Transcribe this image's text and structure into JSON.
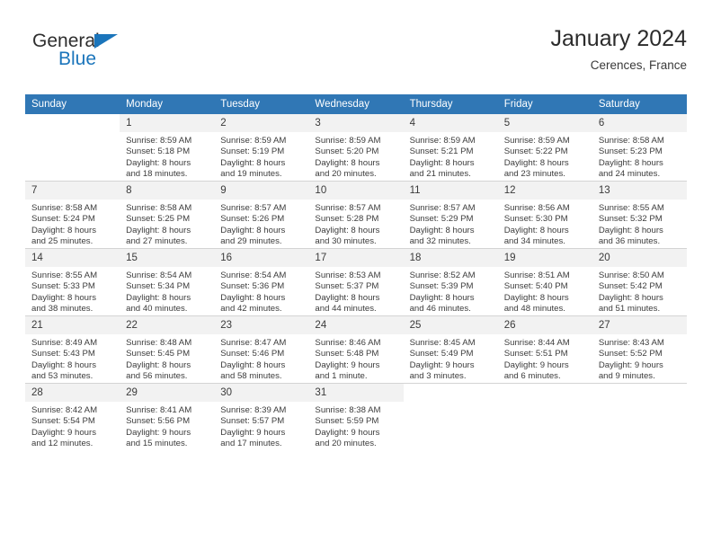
{
  "brand": {
    "name_top": "General",
    "name_bottom": "Blue",
    "accent_color": "#1b75bb"
  },
  "header": {
    "title": "January 2024",
    "subtitle": "Cerences, France",
    "header_bg_color": "#3077b5",
    "daynum_bg_color": "#f2f2f2"
  },
  "weekday_headers": [
    "Sunday",
    "Monday",
    "Tuesday",
    "Wednesday",
    "Thursday",
    "Friday",
    "Saturday"
  ],
  "weeks": [
    [
      {
        "day": "",
        "sunrise": "",
        "sunset": "",
        "daylight_line1": "",
        "daylight_line2": ""
      },
      {
        "day": "1",
        "sunrise": "Sunrise: 8:59 AM",
        "sunset": "Sunset: 5:18 PM",
        "daylight_line1": "Daylight: 8 hours",
        "daylight_line2": "and 18 minutes."
      },
      {
        "day": "2",
        "sunrise": "Sunrise: 8:59 AM",
        "sunset": "Sunset: 5:19 PM",
        "daylight_line1": "Daylight: 8 hours",
        "daylight_line2": "and 19 minutes."
      },
      {
        "day": "3",
        "sunrise": "Sunrise: 8:59 AM",
        "sunset": "Sunset: 5:20 PM",
        "daylight_line1": "Daylight: 8 hours",
        "daylight_line2": "and 20 minutes."
      },
      {
        "day": "4",
        "sunrise": "Sunrise: 8:59 AM",
        "sunset": "Sunset: 5:21 PM",
        "daylight_line1": "Daylight: 8 hours",
        "daylight_line2": "and 21 minutes."
      },
      {
        "day": "5",
        "sunrise": "Sunrise: 8:59 AM",
        "sunset": "Sunset: 5:22 PM",
        "daylight_line1": "Daylight: 8 hours",
        "daylight_line2": "and 23 minutes."
      },
      {
        "day": "6",
        "sunrise": "Sunrise: 8:58 AM",
        "sunset": "Sunset: 5:23 PM",
        "daylight_line1": "Daylight: 8 hours",
        "daylight_line2": "and 24 minutes."
      }
    ],
    [
      {
        "day": "7",
        "sunrise": "Sunrise: 8:58 AM",
        "sunset": "Sunset: 5:24 PM",
        "daylight_line1": "Daylight: 8 hours",
        "daylight_line2": "and 25 minutes."
      },
      {
        "day": "8",
        "sunrise": "Sunrise: 8:58 AM",
        "sunset": "Sunset: 5:25 PM",
        "daylight_line1": "Daylight: 8 hours",
        "daylight_line2": "and 27 minutes."
      },
      {
        "day": "9",
        "sunrise": "Sunrise: 8:57 AM",
        "sunset": "Sunset: 5:26 PM",
        "daylight_line1": "Daylight: 8 hours",
        "daylight_line2": "and 29 minutes."
      },
      {
        "day": "10",
        "sunrise": "Sunrise: 8:57 AM",
        "sunset": "Sunset: 5:28 PM",
        "daylight_line1": "Daylight: 8 hours",
        "daylight_line2": "and 30 minutes."
      },
      {
        "day": "11",
        "sunrise": "Sunrise: 8:57 AM",
        "sunset": "Sunset: 5:29 PM",
        "daylight_line1": "Daylight: 8 hours",
        "daylight_line2": "and 32 minutes."
      },
      {
        "day": "12",
        "sunrise": "Sunrise: 8:56 AM",
        "sunset": "Sunset: 5:30 PM",
        "daylight_line1": "Daylight: 8 hours",
        "daylight_line2": "and 34 minutes."
      },
      {
        "day": "13",
        "sunrise": "Sunrise: 8:55 AM",
        "sunset": "Sunset: 5:32 PM",
        "daylight_line1": "Daylight: 8 hours",
        "daylight_line2": "and 36 minutes."
      }
    ],
    [
      {
        "day": "14",
        "sunrise": "Sunrise: 8:55 AM",
        "sunset": "Sunset: 5:33 PM",
        "daylight_line1": "Daylight: 8 hours",
        "daylight_line2": "and 38 minutes."
      },
      {
        "day": "15",
        "sunrise": "Sunrise: 8:54 AM",
        "sunset": "Sunset: 5:34 PM",
        "daylight_line1": "Daylight: 8 hours",
        "daylight_line2": "and 40 minutes."
      },
      {
        "day": "16",
        "sunrise": "Sunrise: 8:54 AM",
        "sunset": "Sunset: 5:36 PM",
        "daylight_line1": "Daylight: 8 hours",
        "daylight_line2": "and 42 minutes."
      },
      {
        "day": "17",
        "sunrise": "Sunrise: 8:53 AM",
        "sunset": "Sunset: 5:37 PM",
        "daylight_line1": "Daylight: 8 hours",
        "daylight_line2": "and 44 minutes."
      },
      {
        "day": "18",
        "sunrise": "Sunrise: 8:52 AM",
        "sunset": "Sunset: 5:39 PM",
        "daylight_line1": "Daylight: 8 hours",
        "daylight_line2": "and 46 minutes."
      },
      {
        "day": "19",
        "sunrise": "Sunrise: 8:51 AM",
        "sunset": "Sunset: 5:40 PM",
        "daylight_line1": "Daylight: 8 hours",
        "daylight_line2": "and 48 minutes."
      },
      {
        "day": "20",
        "sunrise": "Sunrise: 8:50 AM",
        "sunset": "Sunset: 5:42 PM",
        "daylight_line1": "Daylight: 8 hours",
        "daylight_line2": "and 51 minutes."
      }
    ],
    [
      {
        "day": "21",
        "sunrise": "Sunrise: 8:49 AM",
        "sunset": "Sunset: 5:43 PM",
        "daylight_line1": "Daylight: 8 hours",
        "daylight_line2": "and 53 minutes."
      },
      {
        "day": "22",
        "sunrise": "Sunrise: 8:48 AM",
        "sunset": "Sunset: 5:45 PM",
        "daylight_line1": "Daylight: 8 hours",
        "daylight_line2": "and 56 minutes."
      },
      {
        "day": "23",
        "sunrise": "Sunrise: 8:47 AM",
        "sunset": "Sunset: 5:46 PM",
        "daylight_line1": "Daylight: 8 hours",
        "daylight_line2": "and 58 minutes."
      },
      {
        "day": "24",
        "sunrise": "Sunrise: 8:46 AM",
        "sunset": "Sunset: 5:48 PM",
        "daylight_line1": "Daylight: 9 hours",
        "daylight_line2": "and 1 minute."
      },
      {
        "day": "25",
        "sunrise": "Sunrise: 8:45 AM",
        "sunset": "Sunset: 5:49 PM",
        "daylight_line1": "Daylight: 9 hours",
        "daylight_line2": "and 3 minutes."
      },
      {
        "day": "26",
        "sunrise": "Sunrise: 8:44 AM",
        "sunset": "Sunset: 5:51 PM",
        "daylight_line1": "Daylight: 9 hours",
        "daylight_line2": "and 6 minutes."
      },
      {
        "day": "27",
        "sunrise": "Sunrise: 8:43 AM",
        "sunset": "Sunset: 5:52 PM",
        "daylight_line1": "Daylight: 9 hours",
        "daylight_line2": "and 9 minutes."
      }
    ],
    [
      {
        "day": "28",
        "sunrise": "Sunrise: 8:42 AM",
        "sunset": "Sunset: 5:54 PM",
        "daylight_line1": "Daylight: 9 hours",
        "daylight_line2": "and 12 minutes."
      },
      {
        "day": "29",
        "sunrise": "Sunrise: 8:41 AM",
        "sunset": "Sunset: 5:56 PM",
        "daylight_line1": "Daylight: 9 hours",
        "daylight_line2": "and 15 minutes."
      },
      {
        "day": "30",
        "sunrise": "Sunrise: 8:39 AM",
        "sunset": "Sunset: 5:57 PM",
        "daylight_line1": "Daylight: 9 hours",
        "daylight_line2": "and 17 minutes."
      },
      {
        "day": "31",
        "sunrise": "Sunrise: 8:38 AM",
        "sunset": "Sunset: 5:59 PM",
        "daylight_line1": "Daylight: 9 hours",
        "daylight_line2": "and 20 minutes."
      },
      {
        "day": "",
        "sunrise": "",
        "sunset": "",
        "daylight_line1": "",
        "daylight_line2": ""
      },
      {
        "day": "",
        "sunrise": "",
        "sunset": "",
        "daylight_line1": "",
        "daylight_line2": ""
      },
      {
        "day": "",
        "sunrise": "",
        "sunset": "",
        "daylight_line1": "",
        "daylight_line2": ""
      }
    ]
  ]
}
